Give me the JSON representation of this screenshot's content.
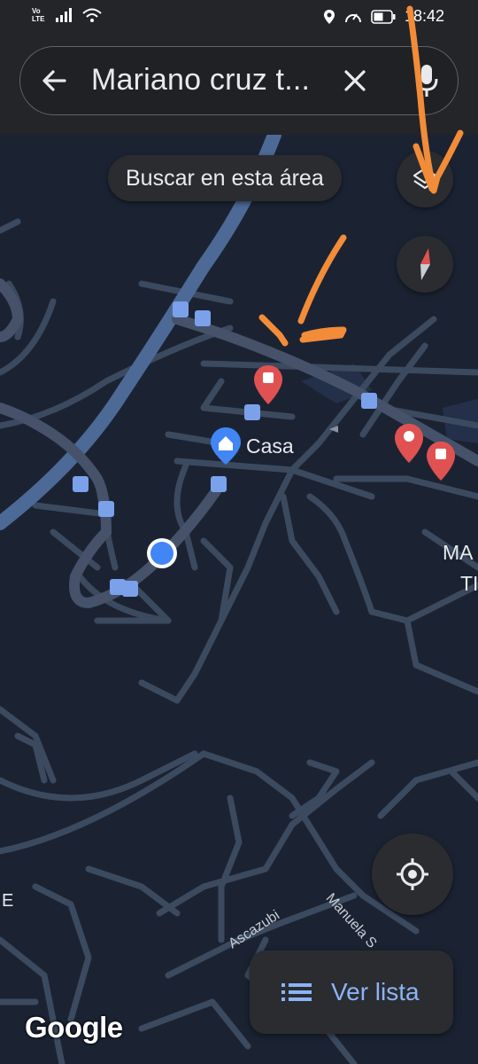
{
  "status_bar": {
    "carrier_badge_top": "Vo",
    "carrier_badge_bottom": "LTE",
    "time": "18:42"
  },
  "search": {
    "back_icon": "arrow-left-icon",
    "query": "Mariano cruz t...",
    "clear_icon": "close-icon",
    "mic_icon": "mic-icon"
  },
  "map": {
    "search_area_button": "Buscar en esta área",
    "home_label": "Casa",
    "edge_label_line1": "MA",
    "edge_label_line2": "TI",
    "left_edge_label": "E",
    "streets": [
      "Ascazubi",
      "Manuela S"
    ],
    "view_list_button": "Ver lista",
    "attribution": "Google",
    "colors": {
      "background": "#1b2333",
      "road": "#3c4a60",
      "main_road": "#4d6a96",
      "transit": "#7ba1ea",
      "poi": "#e05252",
      "location_dot": "#4285f4",
      "annotation": "#f28c38"
    },
    "icons": [
      "layers-icon",
      "compass-icon",
      "my-location-icon",
      "list-icon",
      "bus-stop-icon",
      "train-icon",
      "restaurant-icon",
      "home-pin-icon"
    ]
  }
}
